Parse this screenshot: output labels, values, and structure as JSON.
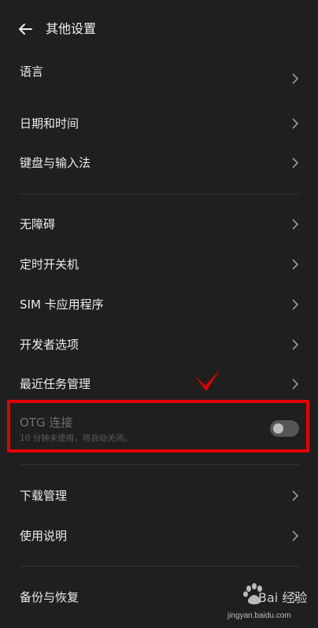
{
  "header": {
    "title": "其他设置"
  },
  "groups": {
    "g1": [
      {
        "label": "语言"
      },
      {
        "label": "日期和时间"
      },
      {
        "label": "键盘与输入法"
      }
    ],
    "g2": [
      {
        "label": "无障碍"
      },
      {
        "label": "定时开关机"
      },
      {
        "label": "SIM 卡应用程序"
      },
      {
        "label": "开发者选项"
      },
      {
        "label": "最近任务管理"
      }
    ],
    "g3": [
      {
        "label": "下载管理"
      },
      {
        "label": "使用说明"
      }
    ],
    "g4": [
      {
        "label": "备份与恢复"
      }
    ]
  },
  "otg": {
    "title": "OTG 连接",
    "subtitle": "10 分钟未使用，将自动关闭。",
    "enabled": false
  },
  "watermark": {
    "brand": "Bai 经验",
    "url": "jingyan.baidu.com"
  },
  "colors": {
    "highlight": "#e30000",
    "background": "#1f1f1f"
  }
}
